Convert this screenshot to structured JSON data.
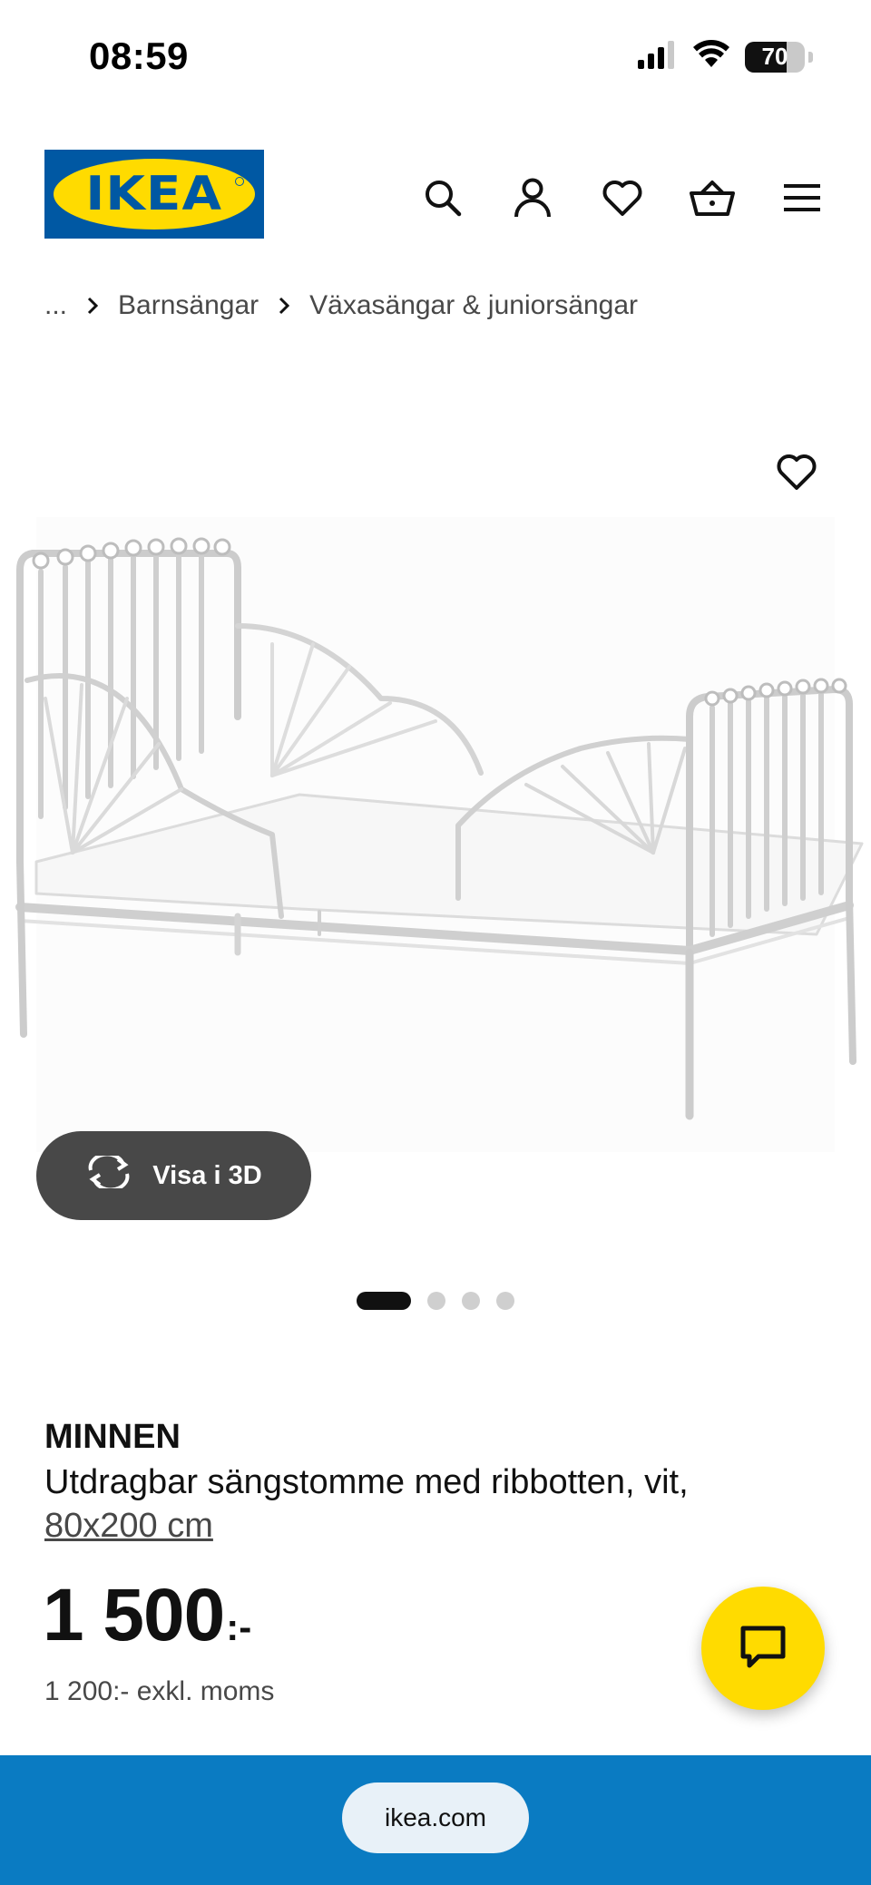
{
  "status_bar": {
    "time": "08:59",
    "battery": "70",
    "battery_level": 0.7,
    "icons": [
      "signal-icon",
      "wifi-icon",
      "battery-icon"
    ]
  },
  "header": {
    "logo_text": "IKEA",
    "brand_colors": {
      "blue": "#0058a3",
      "yellow": "#ffdb00"
    },
    "icons": [
      "search-icon",
      "account-icon",
      "heart-icon",
      "basket-icon",
      "menu-icon"
    ]
  },
  "breadcrumb": {
    "items": [
      "...",
      "Barnsängar",
      "Växasängar & juniorsängar"
    ]
  },
  "gallery": {
    "view_3d_label": "Visa i 3D",
    "image_count": 4,
    "active_index": 0
  },
  "product": {
    "name": "MINNEN",
    "description": "Utdragbar sängstomme med ribbotten, vit,",
    "size": "80x200 cm",
    "price": "1 500",
    "price_suffix": ":-",
    "price_ex_vat": "1 200:- exkl. moms"
  },
  "chat": {
    "icon": "chat-icon",
    "color": "#ffdb00"
  },
  "browser": {
    "url": "ikea.com",
    "bar_color": "#0a7bc2"
  }
}
